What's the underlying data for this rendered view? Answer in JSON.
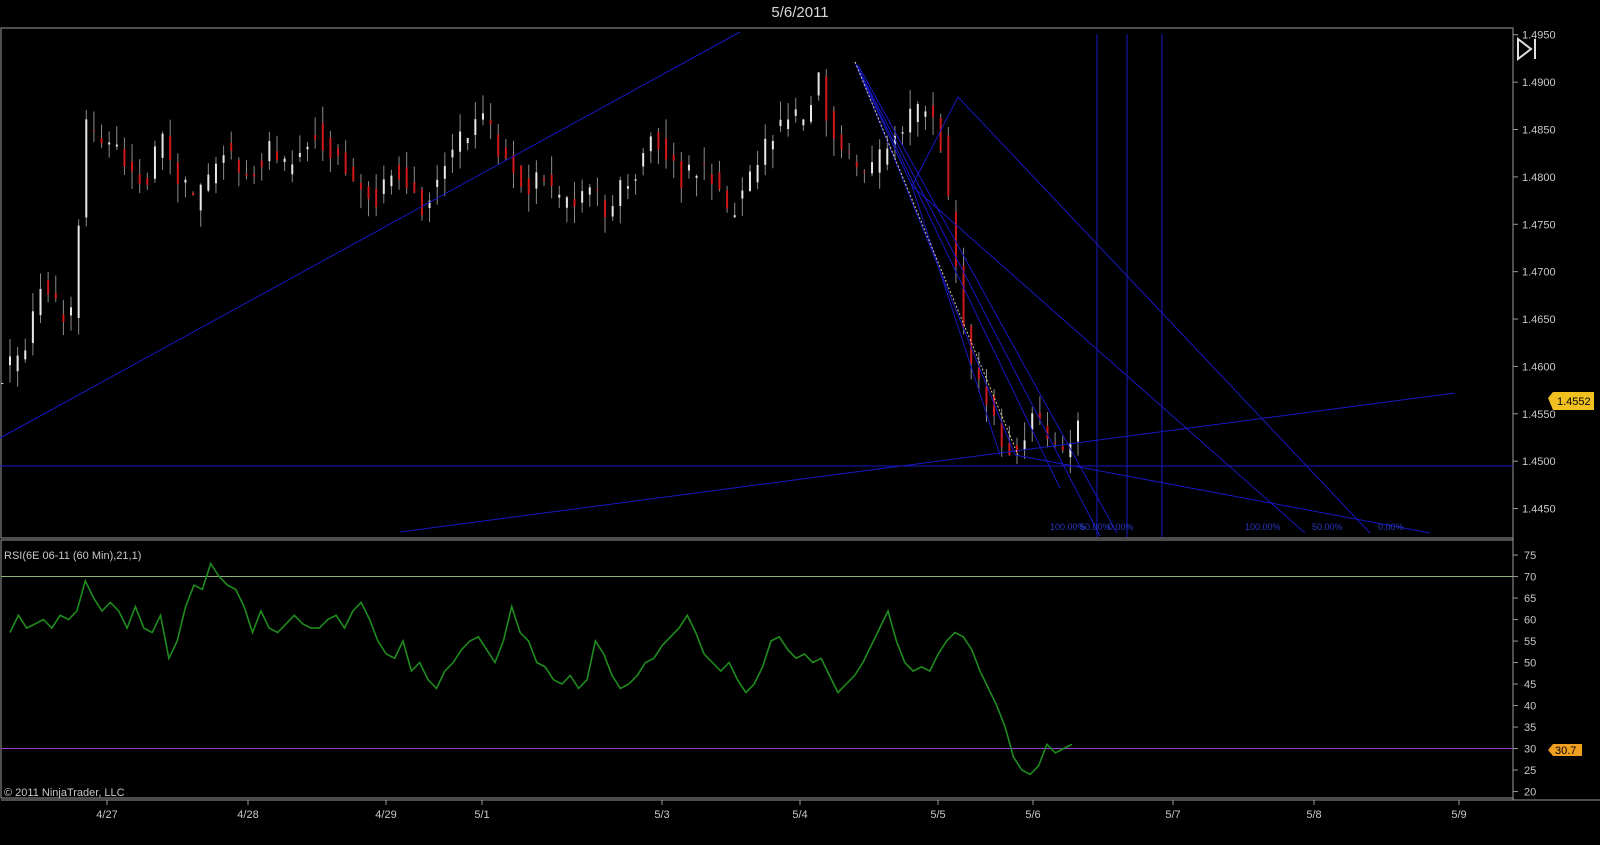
{
  "title": "5/6/2011",
  "copyright": "© 2011 NinjaTrader, LLC",
  "price_panel": {
    "y_ticks": [
      "1.4950",
      "1.4900",
      "1.4850",
      "1.4800",
      "1.4750",
      "1.4700",
      "1.4650",
      "1.4600",
      "1.4550",
      "1.4500",
      "1.4450"
    ],
    "last_price": "1.4552",
    "fib_labels": [
      "100.00%",
      "50.00%",
      "0.00%",
      "100.00%",
      "50.00%",
      "0.00%"
    ]
  },
  "rsi_panel": {
    "label": "RSI(6E 06-11 (60 Min),21,1)",
    "y_ticks": [
      "75",
      "70",
      "65",
      "60",
      "55",
      "50",
      "45",
      "40",
      "35",
      "30",
      "25",
      "20"
    ],
    "last_value": "30.7",
    "upper_band": 70,
    "lower_band": 30
  },
  "x_ticks": [
    "4/27",
    "4/28",
    "4/29",
    "5/1",
    "5/3",
    "5/4",
    "5/5",
    "5/6",
    "5/7",
    "5/8",
    "5/9"
  ],
  "colors": {
    "up_bar": "#e8e8e8",
    "down_bar": "#d01818",
    "drawing": "#1818c0",
    "rsi_line": "#1f8c1f",
    "upper_band": "#8fb07a",
    "lower_band": "#9a3cc8",
    "price_marker": "#f0c020"
  },
  "chart_data": {
    "type": "candlestick",
    "title": "5/6/2011",
    "ylim": [
      1.442,
      1.4955
    ],
    "x": [
      "4/27",
      "4/28",
      "4/29",
      "5/1",
      "5/3",
      "5/4",
      "5/5",
      "5/6",
      "5/7",
      "5/8",
      "5/9"
    ],
    "close": [
      1.46,
      1.462,
      1.469,
      1.466,
      1.465,
      1.485,
      1.484,
      1.483,
      1.481,
      1.48,
      1.484,
      1.48,
      1.477,
      1.48,
      1.483,
      1.481,
      1.481,
      1.483,
      1.481,
      1.483,
      1.485,
      1.483,
      1.481,
      1.479,
      1.478,
      1.481,
      1.48,
      1.477,
      1.48,
      1.483,
      1.485,
      1.486,
      1.483,
      1.481,
      1.479,
      1.48,
      1.477,
      1.478,
      1.479,
      1.476,
      1.479,
      1.481,
      1.485,
      1.482,
      1.48,
      1.481,
      1.48,
      1.476,
      1.478,
      1.481,
      1.485,
      1.486,
      1.486,
      1.49,
      1.484,
      1.482,
      1.48,
      1.482,
      1.484,
      1.486,
      1.487,
      1.484,
      1.47,
      1.46,
      1.457,
      1.452,
      1.451,
      1.455,
      1.452,
      1.45,
      1.455
    ],
    "rsi": [
      57,
      61,
      58,
      59,
      60,
      58,
      61,
      60,
      62,
      69,
      65,
      62,
      64,
      62,
      58,
      63,
      58,
      57,
      61,
      51,
      55,
      63,
      68,
      67,
      73,
      70,
      68,
      67,
      63,
      57,
      62,
      58,
      57,
      59,
      61,
      59,
      58,
      58,
      60,
      61,
      58,
      62,
      64,
      60,
      55,
      52,
      51,
      55,
      48,
      50,
      46,
      44,
      48,
      50,
      53,
      55,
      56,
      53,
      50,
      55,
      63,
      57,
      55,
      50,
      49,
      46,
      45,
      47,
      44,
      46,
      55,
      52,
      47,
      44,
      45,
      47,
      50,
      51,
      54,
      56,
      58,
      61,
      57,
      52,
      50,
      48,
      50,
      46,
      43,
      45,
      49,
      55,
      56,
      53,
      51,
      52,
      50,
      51,
      47,
      43,
      45,
      47,
      50,
      54,
      58,
      62,
      55,
      50,
      48,
      49,
      48,
      52,
      55,
      57,
      56,
      53,
      48,
      44,
      40,
      35,
      28,
      25,
      24,
      26,
      31,
      29,
      30,
      31
    ]
  }
}
